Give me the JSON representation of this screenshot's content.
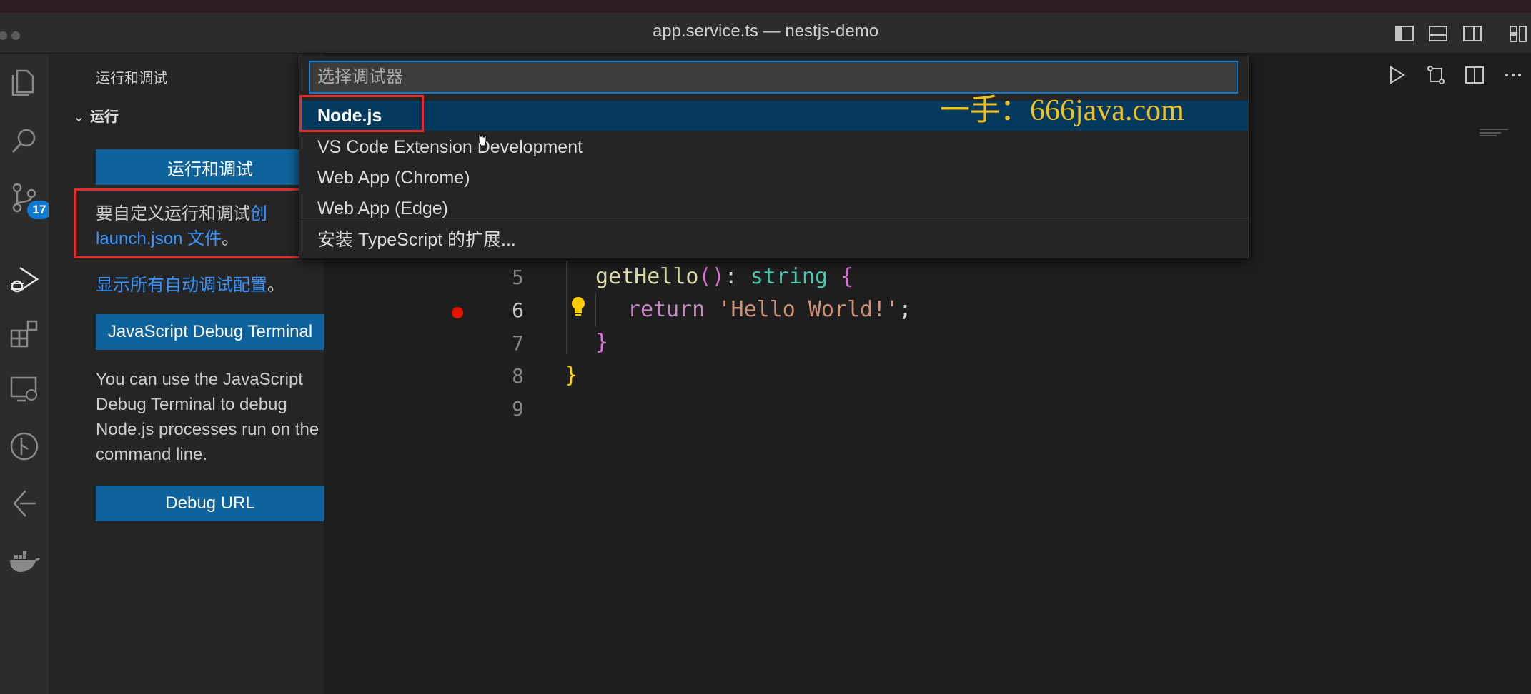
{
  "window": {
    "title": "app.service.ts — nestjs-demo"
  },
  "activity_bar": {
    "items": [
      {
        "name": "explorer",
        "icon": "files-icon"
      },
      {
        "name": "search",
        "icon": "search-icon"
      },
      {
        "name": "source-control",
        "icon": "source-control-icon",
        "badge": "17"
      },
      {
        "name": "run-and-debug",
        "icon": "run-debug-icon",
        "active": true
      },
      {
        "name": "extensions",
        "icon": "extensions-icon"
      },
      {
        "name": "remote-explorer",
        "icon": "remote-explorer-icon"
      },
      {
        "name": "git-graph",
        "icon": "git-graph-icon"
      },
      {
        "name": "tree",
        "icon": "tree-icon"
      },
      {
        "name": "docker",
        "icon": "docker-icon"
      }
    ]
  },
  "sidebar": {
    "header": "运行和调试",
    "section": "运行",
    "run_button": "运行和调试",
    "customize_text": "要自定义运行和调试",
    "customize_link_part": "创",
    "launch_link": "launch.json 文件",
    "launch_suffix": "。",
    "show_all_link": "显示所有自动调试配置",
    "show_all_suffix": "。",
    "js_debug_button": "JavaScript Debug Terminal",
    "js_debug_desc": [
      "You can use the JavaScript",
      "Debug Terminal to debug",
      "Node.js processes run on the",
      "command line."
    ],
    "debug_url_button": "Debug URL"
  },
  "quick_pick": {
    "placeholder": "选择调试器",
    "items": [
      {
        "label": "Node.js",
        "selected": true
      },
      {
        "label": "VS Code Extension Development"
      },
      {
        "label": "Web App (Chrome)"
      },
      {
        "label": "Web App (Edge)"
      },
      {
        "label": "安装 TypeScript 的扩展..."
      }
    ]
  },
  "watermark": "一手：666java.com",
  "editor": {
    "lines": [
      {
        "number": "5"
      },
      {
        "number": "6",
        "current": true,
        "breakpoint": true
      },
      {
        "number": "7"
      },
      {
        "number": "8"
      },
      {
        "number": "9"
      }
    ],
    "code": {
      "l5_fn": "getHello",
      "l5_parens": "()",
      "l5_colon": ": ",
      "l5_type": "string",
      "l5_brace": " {",
      "l6_kw": "return",
      "l6_str": "'Hello World!'",
      "l6_semi": ";",
      "l7": "}",
      "l8": "}"
    }
  },
  "colors": {
    "accent": "#0e639c",
    "selection": "#04395e",
    "highlight_box": "#ea2a2a",
    "breakpoint": "#e51400",
    "watermark": "#f0c020"
  }
}
